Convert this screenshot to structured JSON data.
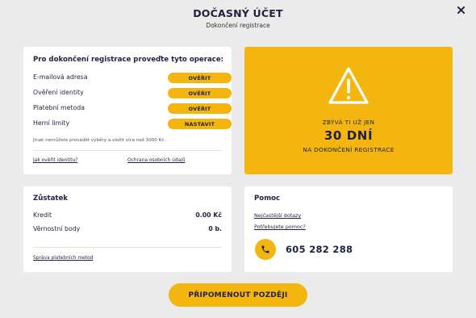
{
  "modal": {
    "title": "DOČASNÝ ÚČET",
    "subtitle": "Dokončení registrace",
    "close_icon": "close-icon"
  },
  "steps": {
    "heading": "Pro dokončení registrace proveďte tyto operace:",
    "items": [
      {
        "label": "E-mailová adresa",
        "button": "OVĚŘIT"
      },
      {
        "label": "Ověření identity",
        "button": "OVĚŘIT"
      },
      {
        "label": "Platební metoda",
        "button": "OVĚŘIT"
      },
      {
        "label": "Herní limity",
        "button": "NASTAVIT"
      }
    ],
    "note": "Jinak nemůžete provádět výběry a vložit více než 3000 Kč.",
    "link_identity": "Jak ověřit identitu?",
    "link_privacy": "Ochrana osobních údajů"
  },
  "countdown": {
    "icon": "warning-icon",
    "remaining": "ZBÝVÁ TI UŽ JEN",
    "days": "30 DNÍ",
    "completion": "NA DOKONČENÍ REGISTRACE"
  },
  "balance": {
    "heading": "Zůstatek",
    "credit_label": "Kredit",
    "credit_value": "0.00 Kč",
    "loyalty_label": "Věrnostní body",
    "loyalty_value": "0 b.",
    "manage_link": "Správa platebních metod"
  },
  "help": {
    "heading": "Pomoc",
    "faq_link": "Nejčastější dotazy",
    "need_help_link": "Potřebujete pomoc?",
    "phone_icon": "phone-icon",
    "phone": "605 282 288"
  },
  "footer": {
    "remind_label": "PŘIPOMENOUT POZDĚJI"
  },
  "colors": {
    "accent": "#f5b50f",
    "text": "#1e2240",
    "background": "#ebebeb"
  }
}
